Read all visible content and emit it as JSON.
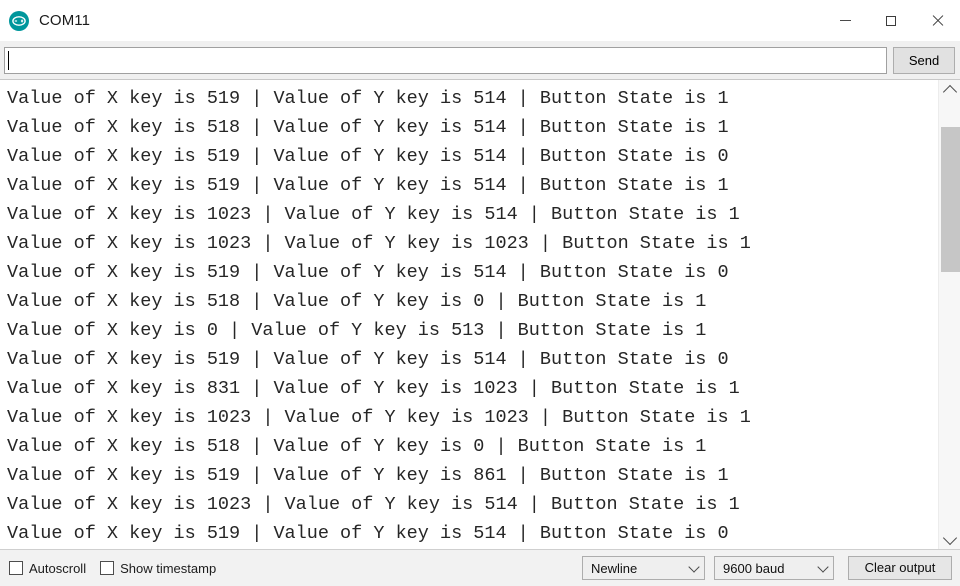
{
  "window": {
    "title": "COM11",
    "app_icon": "arduino-icon",
    "minimize_label": "Minimize",
    "maximize_label": "Maximize",
    "close_label": "Close"
  },
  "send_bar": {
    "input_value": "",
    "input_placeholder": "",
    "send_label": "Send"
  },
  "output": {
    "lines": [
      "Value of X key is 519 | Value of Y key is 514 | Button State is 1",
      "Value of X key is 518 | Value of Y key is 514 | Button State is 1",
      "Value of X key is 519 | Value of Y key is 514 | Button State is 0",
      "Value of X key is 519 | Value of Y key is 514 | Button State is 1",
      "Value of X key is 1023 | Value of Y key is 514 | Button State is 1",
      "Value of X key is 1023 | Value of Y key is 1023 | Button State is 1",
      "Value of X key is 519 | Value of Y key is 514 | Button State is 0",
      "Value of X key is 518 | Value of Y key is 0 | Button State is 1",
      "Value of X key is 0 | Value of Y key is 513 | Button State is 1",
      "Value of X key is 519 | Value of Y key is 514 | Button State is 0",
      "Value of X key is 831 | Value of Y key is 1023 | Button State is 1",
      "Value of X key is 1023 | Value of Y key is 1023 | Button State is 1",
      "Value of X key is 518 | Value of Y key is 0 | Button State is 1",
      "Value of X key is 519 | Value of Y key is 861 | Button State is 1",
      "Value of X key is 1023 | Value of Y key is 514 | Button State is 1",
      "Value of X key is 519 | Value of Y key is 514 | Button State is 0"
    ]
  },
  "scrollbar": {
    "up_arrow": "chevron-up-icon",
    "down_arrow": "chevron-down-icon"
  },
  "status_bar": {
    "autoscroll_label": "Autoscroll",
    "autoscroll_checked": false,
    "timestamp_label": "Show timestamp",
    "timestamp_checked": false,
    "line_ending": "Newline",
    "baud_rate": "9600 baud",
    "clear_label": "Clear output"
  },
  "colors": {
    "accent": "#00979c",
    "window_bg": "#ffffff",
    "chrome_bg": "#f0f0f0",
    "status_bg": "#f2f2f2",
    "text": "#262626",
    "scroll_thumb": "#c6c6c6"
  }
}
